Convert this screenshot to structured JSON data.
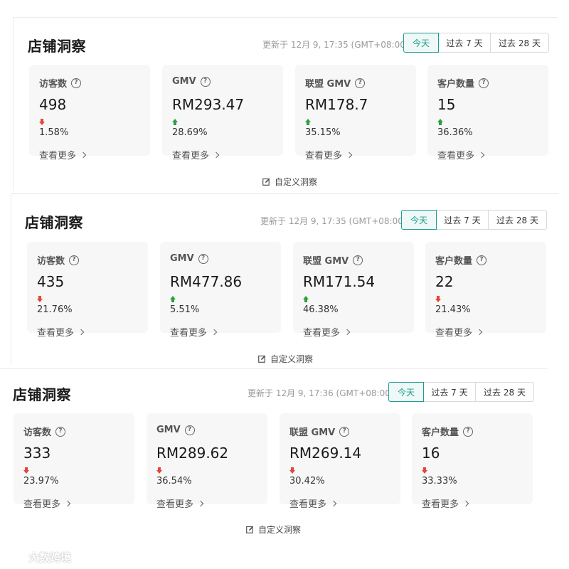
{
  "panels": [
    {
      "title": "店铺洞察",
      "updated": "更新于 12月 9, 17:35 (GMT+08:00)",
      "range": [
        "今天",
        "过去 7 天",
        "过去 28 天"
      ],
      "cards": [
        {
          "label": "访客数",
          "value": "498",
          "trend": "down",
          "pct": "1.58%",
          "more": "查看更多"
        },
        {
          "label": "GMV",
          "value": "RM293.47",
          "trend": "up",
          "pct": "28.69%",
          "more": "查看更多"
        },
        {
          "label": "联盟 GMV",
          "value": "RM178.7",
          "trend": "up",
          "pct": "35.15%",
          "more": "查看更多"
        },
        {
          "label": "客户数量",
          "value": "15",
          "trend": "up",
          "pct": "36.36%",
          "more": "查看更多"
        }
      ],
      "customize": "自定义洞察"
    },
    {
      "title": "店铺洞察",
      "updated": "更新于 12月 9, 17:35 (GMT+08:00)",
      "range": [
        "今天",
        "过去 7 天",
        "过去 28 天"
      ],
      "cards": [
        {
          "label": "访客数",
          "value": "435",
          "trend": "down",
          "pct": "21.76%",
          "more": "查看更多"
        },
        {
          "label": "GMV",
          "value": "RM477.86",
          "trend": "up",
          "pct": "5.51%",
          "more": "查看更多"
        },
        {
          "label": "联盟 GMV",
          "value": "RM171.54",
          "trend": "up",
          "pct": "46.38%",
          "more": "查看更多"
        },
        {
          "label": "客户数量",
          "value": "22",
          "trend": "down",
          "pct": "21.43%",
          "more": "查看更多"
        }
      ],
      "customize": "自定义洞察"
    },
    {
      "title": "店铺洞察",
      "updated": "更新于 12月 9, 17:36 (GMT+08:00)",
      "range": [
        "今天",
        "过去 7 天",
        "过去 28 天"
      ],
      "cards": [
        {
          "label": "访客数",
          "value": "333",
          "trend": "down",
          "pct": "23.97%",
          "more": "查看更多"
        },
        {
          "label": "GMV",
          "value": "RM289.62",
          "trend": "down",
          "pct": "36.54%",
          "more": "查看更多"
        },
        {
          "label": "联盟 GMV",
          "value": "RM269.14",
          "trend": "down",
          "pct": "30.42%",
          "more": "查看更多"
        },
        {
          "label": "客户数量",
          "value": "16",
          "trend": "down",
          "pct": "33.33%",
          "more": "查看更多"
        }
      ],
      "customize": "自定义洞察"
    }
  ],
  "colors": {
    "accent": "#1b9c8f",
    "trend_up": "#2e9e3e",
    "trend_down": "#e0483a"
  },
  "icons": {
    "help": "question-circle-icon",
    "trend_up": "arrow-up-icon",
    "trend_down": "arrow-down-icon",
    "chevron": "chevron-right-icon",
    "edit": "edit-icon"
  },
  "watermark": "大数跨境"
}
